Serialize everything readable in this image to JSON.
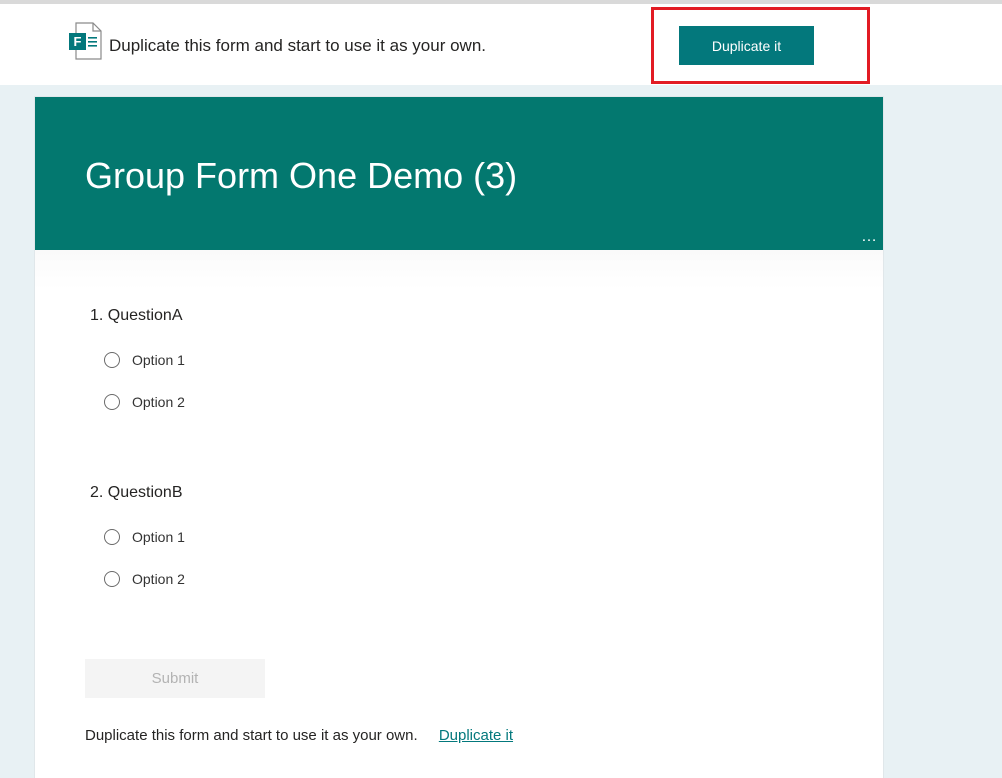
{
  "banner": {
    "text": "Duplicate this form and start to use it as your own.",
    "button_label": "Duplicate it",
    "logo_letter": "F"
  },
  "form": {
    "title": "Group Form One Demo (3)",
    "more_icon": "…",
    "questions": [
      {
        "title": "1. QuestionA",
        "options": [
          "Option 1",
          "Option 2"
        ]
      },
      {
        "title": "2. QuestionB",
        "options": [
          "Option 1",
          "Option 2"
        ]
      }
    ],
    "submit_label": "Submit",
    "footer_text": "Duplicate this form and start to use it as your own.",
    "footer_link": "Duplicate it"
  },
  "colors": {
    "accent": "#03787c",
    "header": "#03786f",
    "highlight": "#e21b23",
    "page_bg": "#e8f1f4"
  }
}
